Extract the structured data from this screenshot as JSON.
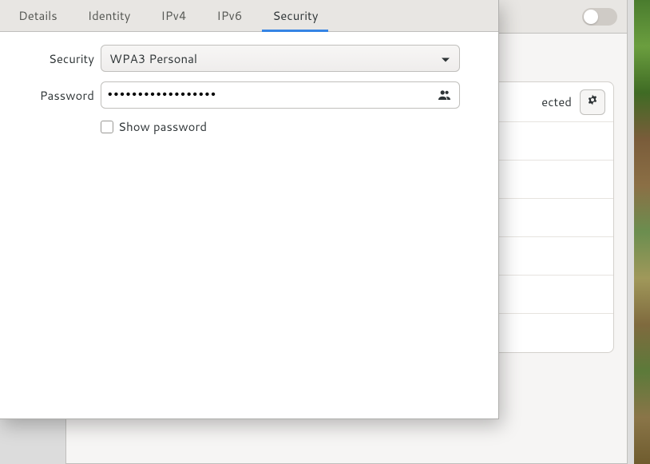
{
  "tabs": {
    "details": "Details",
    "identity": "Identity",
    "ipv4": "IPv4",
    "ipv6": "IPv6",
    "security": "Security"
  },
  "form": {
    "security_label": "Security",
    "security_value": "WPA3 Personal",
    "password_label": "Password",
    "password_value": "••••••••••••••••••",
    "show_password_label": "Show password"
  },
  "background": {
    "row0_status": "ected"
  }
}
